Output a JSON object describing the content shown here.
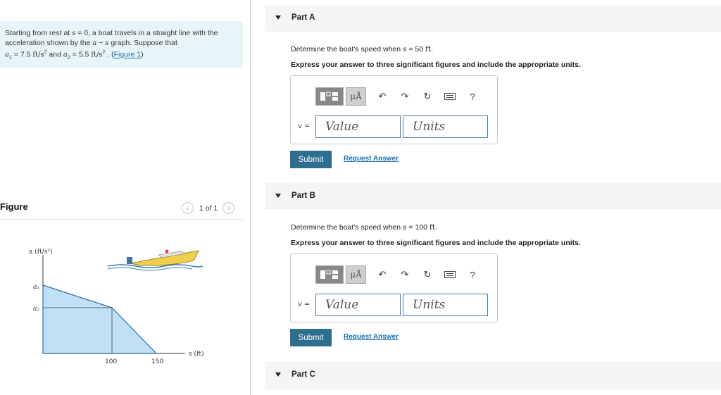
{
  "problem": {
    "text1": "Starting from rest at ",
    "s_sym": "s",
    "text2": " = 0, a boat travels in a straight line with the acceleration shown by the ",
    "a_sym": "a",
    "text3": " − ",
    "s_sym2": "s",
    "text4": " graph. Suppose that",
    "a1_sym": "a",
    "a1_sub": "1",
    "a1_val": " = 7.5 ",
    "a1_unit": "ft/s",
    "sq1": "2",
    "and_text": " and ",
    "a2_sym": "a",
    "a2_sub": "2",
    "a2_val": " = 5.5 ",
    "a2_unit": "ft/s",
    "sq2": "2",
    "period_text": " . (",
    "figure_link": "Figure 1",
    "close_paren": ")"
  },
  "figure": {
    "title": "Figure",
    "pager_text": "1 of 1",
    "y_axis_label": "a (ft/s²)",
    "x_axis_label": "s (ft)",
    "a1_label": "a₁",
    "a2_label": "a₂",
    "x_tick_100": "100",
    "x_tick_150": "150"
  },
  "parts": [
    {
      "title": "Part A",
      "question_pre": "Determine the boat's speed when ",
      "var": "s",
      "question_eq": " = 50 ",
      "unit": "ft",
      "question_post": ".",
      "instruction": "Express your answer to three significant figures and include the appropriate units.",
      "var_label": "v",
      "eq": " =",
      "value_placeholder": "Value",
      "units_placeholder": "Units",
      "submit": "Submit",
      "request": "Request Answer"
    },
    {
      "title": "Part B",
      "question_pre": "Determine the boat's speed when ",
      "var": "s",
      "question_eq": " = 100 ",
      "unit": "ft",
      "question_post": ".",
      "instruction": "Express your answer to three significant figures and include the appropriate units.",
      "var_label": "v",
      "eq": " =",
      "value_placeholder": "Value",
      "units_placeholder": "Units",
      "submit": "Submit",
      "request": "Request Answer"
    },
    {
      "title": "Part C"
    }
  ],
  "toolbar": {
    "mu_a": "μÅ",
    "help": "?"
  },
  "colors": {
    "problem_bg": "#e8f5f8",
    "submit_bg": "#2e6e8f",
    "link": "#1a6fb0",
    "graph_fill": "#bfe0f5"
  }
}
